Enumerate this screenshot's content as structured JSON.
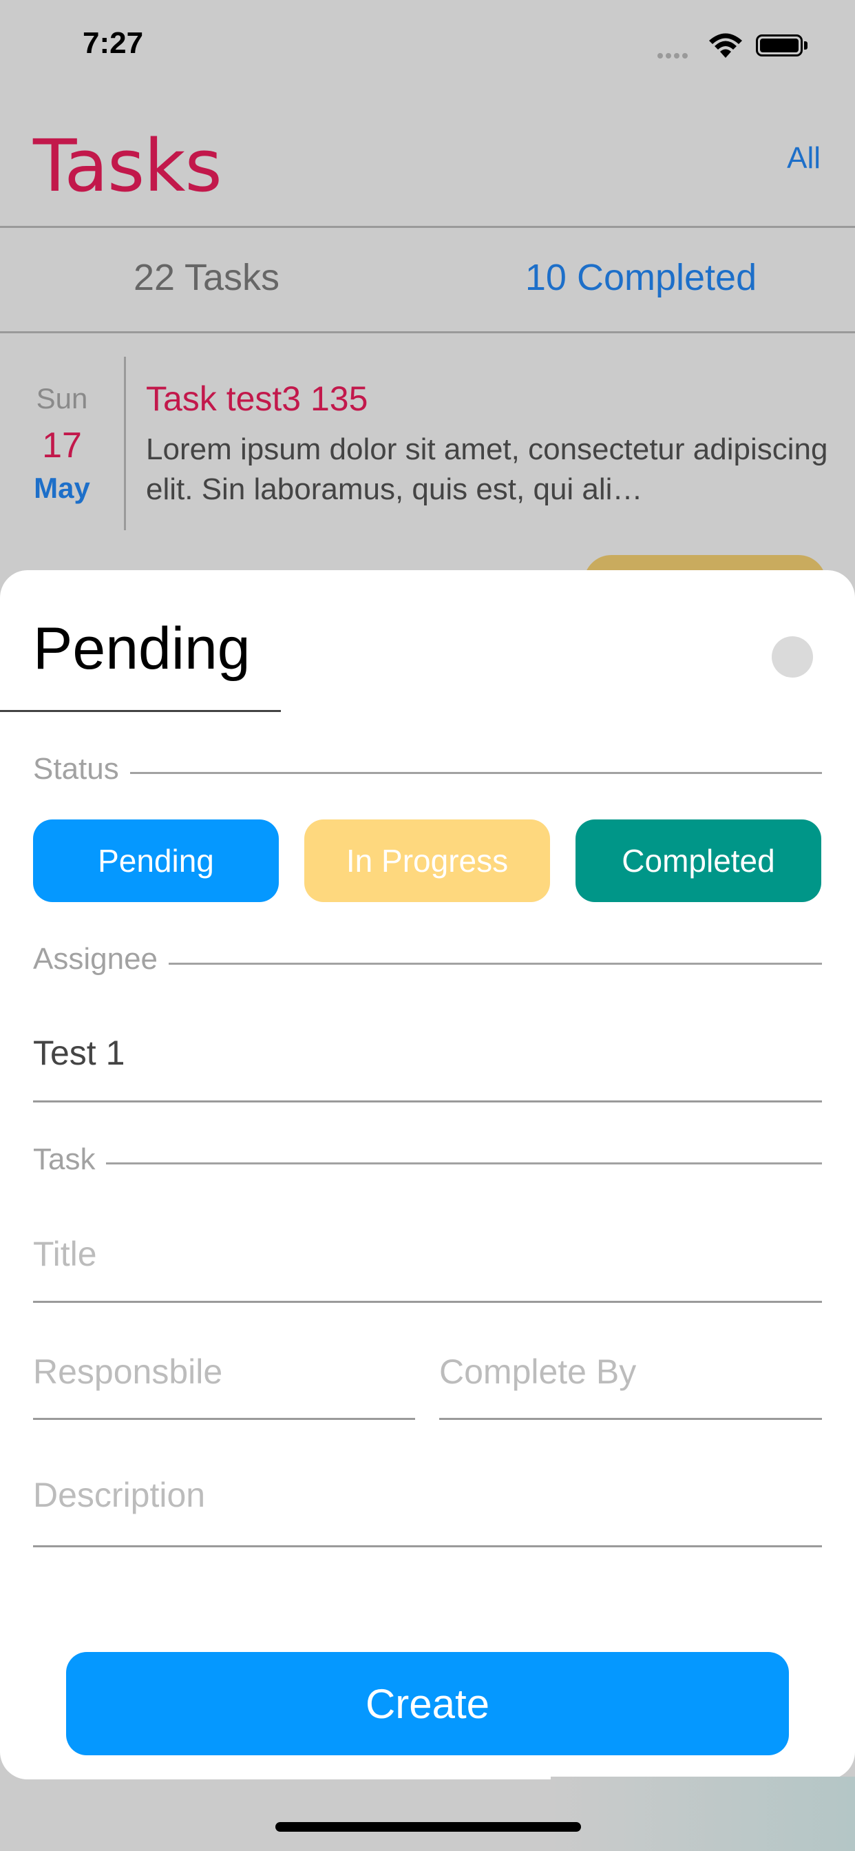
{
  "status_bar": {
    "time": "7:27",
    "icons": [
      "signal-dots-icon",
      "wifi-icon",
      "battery-icon"
    ]
  },
  "header": {
    "title": "Tasks",
    "filter_label": "All"
  },
  "stats": {
    "tasks": "22 Tasks",
    "completed": "10 Completed"
  },
  "task_card": {
    "day": "Sun",
    "date": "17",
    "month": "May",
    "title": "Task test3 135",
    "description": "Lorem ipsum dolor sit amet, consectetur adipiscing elit. Sin laboramus, quis est, qui ali…"
  },
  "sheet": {
    "title": "Pending",
    "status_label": "Status",
    "status_options": [
      "Pending",
      "In Progress",
      "Completed"
    ],
    "assignee_label": "Assignee",
    "assignee_value": "Test 1",
    "task_label": "Task",
    "title_placeholder": "Title",
    "responsible_placeholder": "Responsbile",
    "complete_by_placeholder": "Complete By",
    "description_placeholder": "Description",
    "create_label": "Create"
  },
  "colors": {
    "accent_red": "#c2184b",
    "accent_blue": "#1d6fc9",
    "pending": "#0598ff",
    "in_progress": "#fed87e",
    "completed": "#009688"
  }
}
